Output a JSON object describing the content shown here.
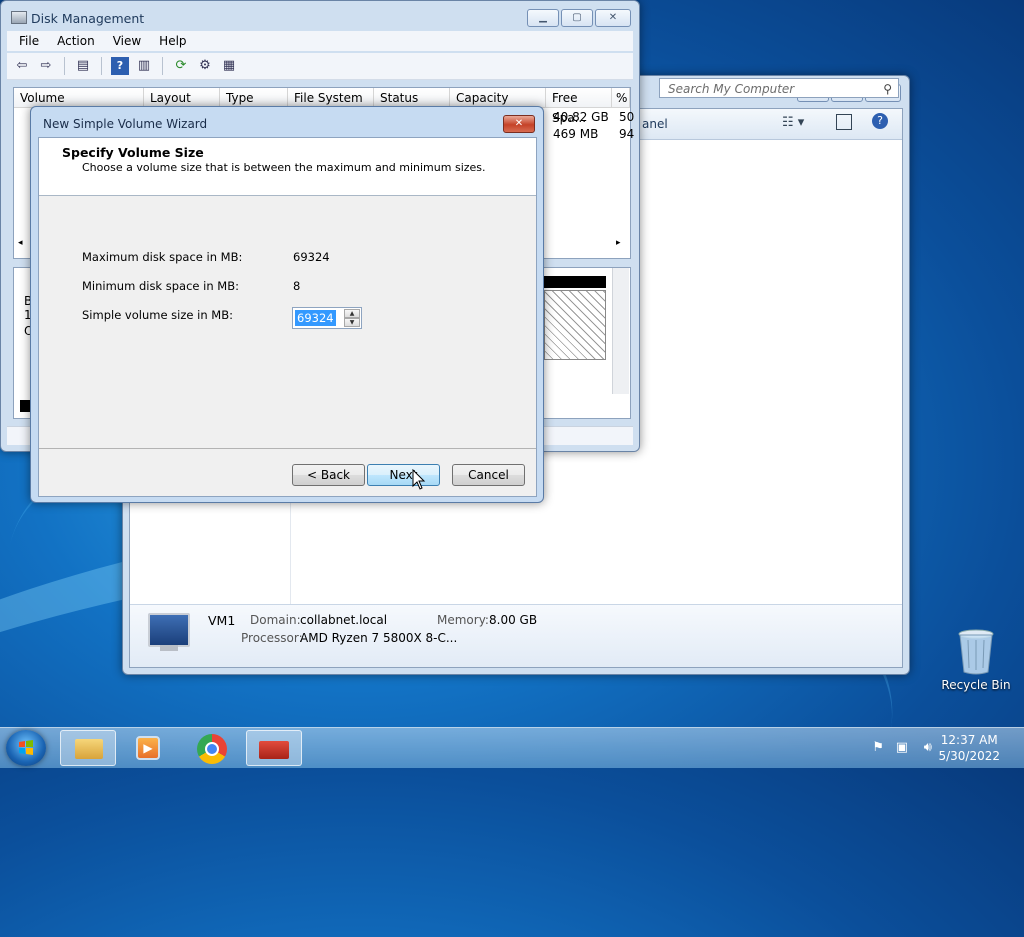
{
  "explorer": {
    "search_placeholder": "Search My Computer",
    "cmd_text": "anel",
    "footer": {
      "computer_name": "VM1",
      "domain_label": "Domain:",
      "domain_value": "collabnet.local",
      "memory_label": "Memory:",
      "memory_value": "8.00 GB",
      "processor_label": "Processor:",
      "processor_value": "AMD Ryzen 7 5800X 8-C..."
    }
  },
  "disk_management": {
    "title": "Disk Management",
    "menu": [
      "File",
      "Action",
      "View",
      "Help"
    ],
    "columns": [
      "Volume",
      "Layout",
      "Type",
      "File System",
      "Status",
      "Capacity",
      "Free Spa...",
      "%"
    ],
    "rows": [
      {
        "free": "40.82 GB",
        "pct": "50"
      },
      {
        "free": "469 MB",
        "pct": "94"
      }
    ],
    "lower_labels": [
      "B",
      "1:",
      "O"
    ]
  },
  "wizard": {
    "title": "New Simple Volume Wizard",
    "heading": "Specify Volume Size",
    "subheading": "Choose a volume size that is between the maximum and minimum sizes.",
    "max_label": "Maximum disk space in MB:",
    "max_value": "69324",
    "min_label": "Minimum disk space in MB:",
    "min_value": "8",
    "size_label": "Simple volume size in MB:",
    "size_value": "69324",
    "back_label": "< Back",
    "next_label": "Next",
    "cancel_label": "Cancel"
  },
  "desktop": {
    "recycle_bin": "Recycle Bin"
  },
  "taskbar": {
    "time": "12:37 AM",
    "date": "5/30/2022"
  }
}
